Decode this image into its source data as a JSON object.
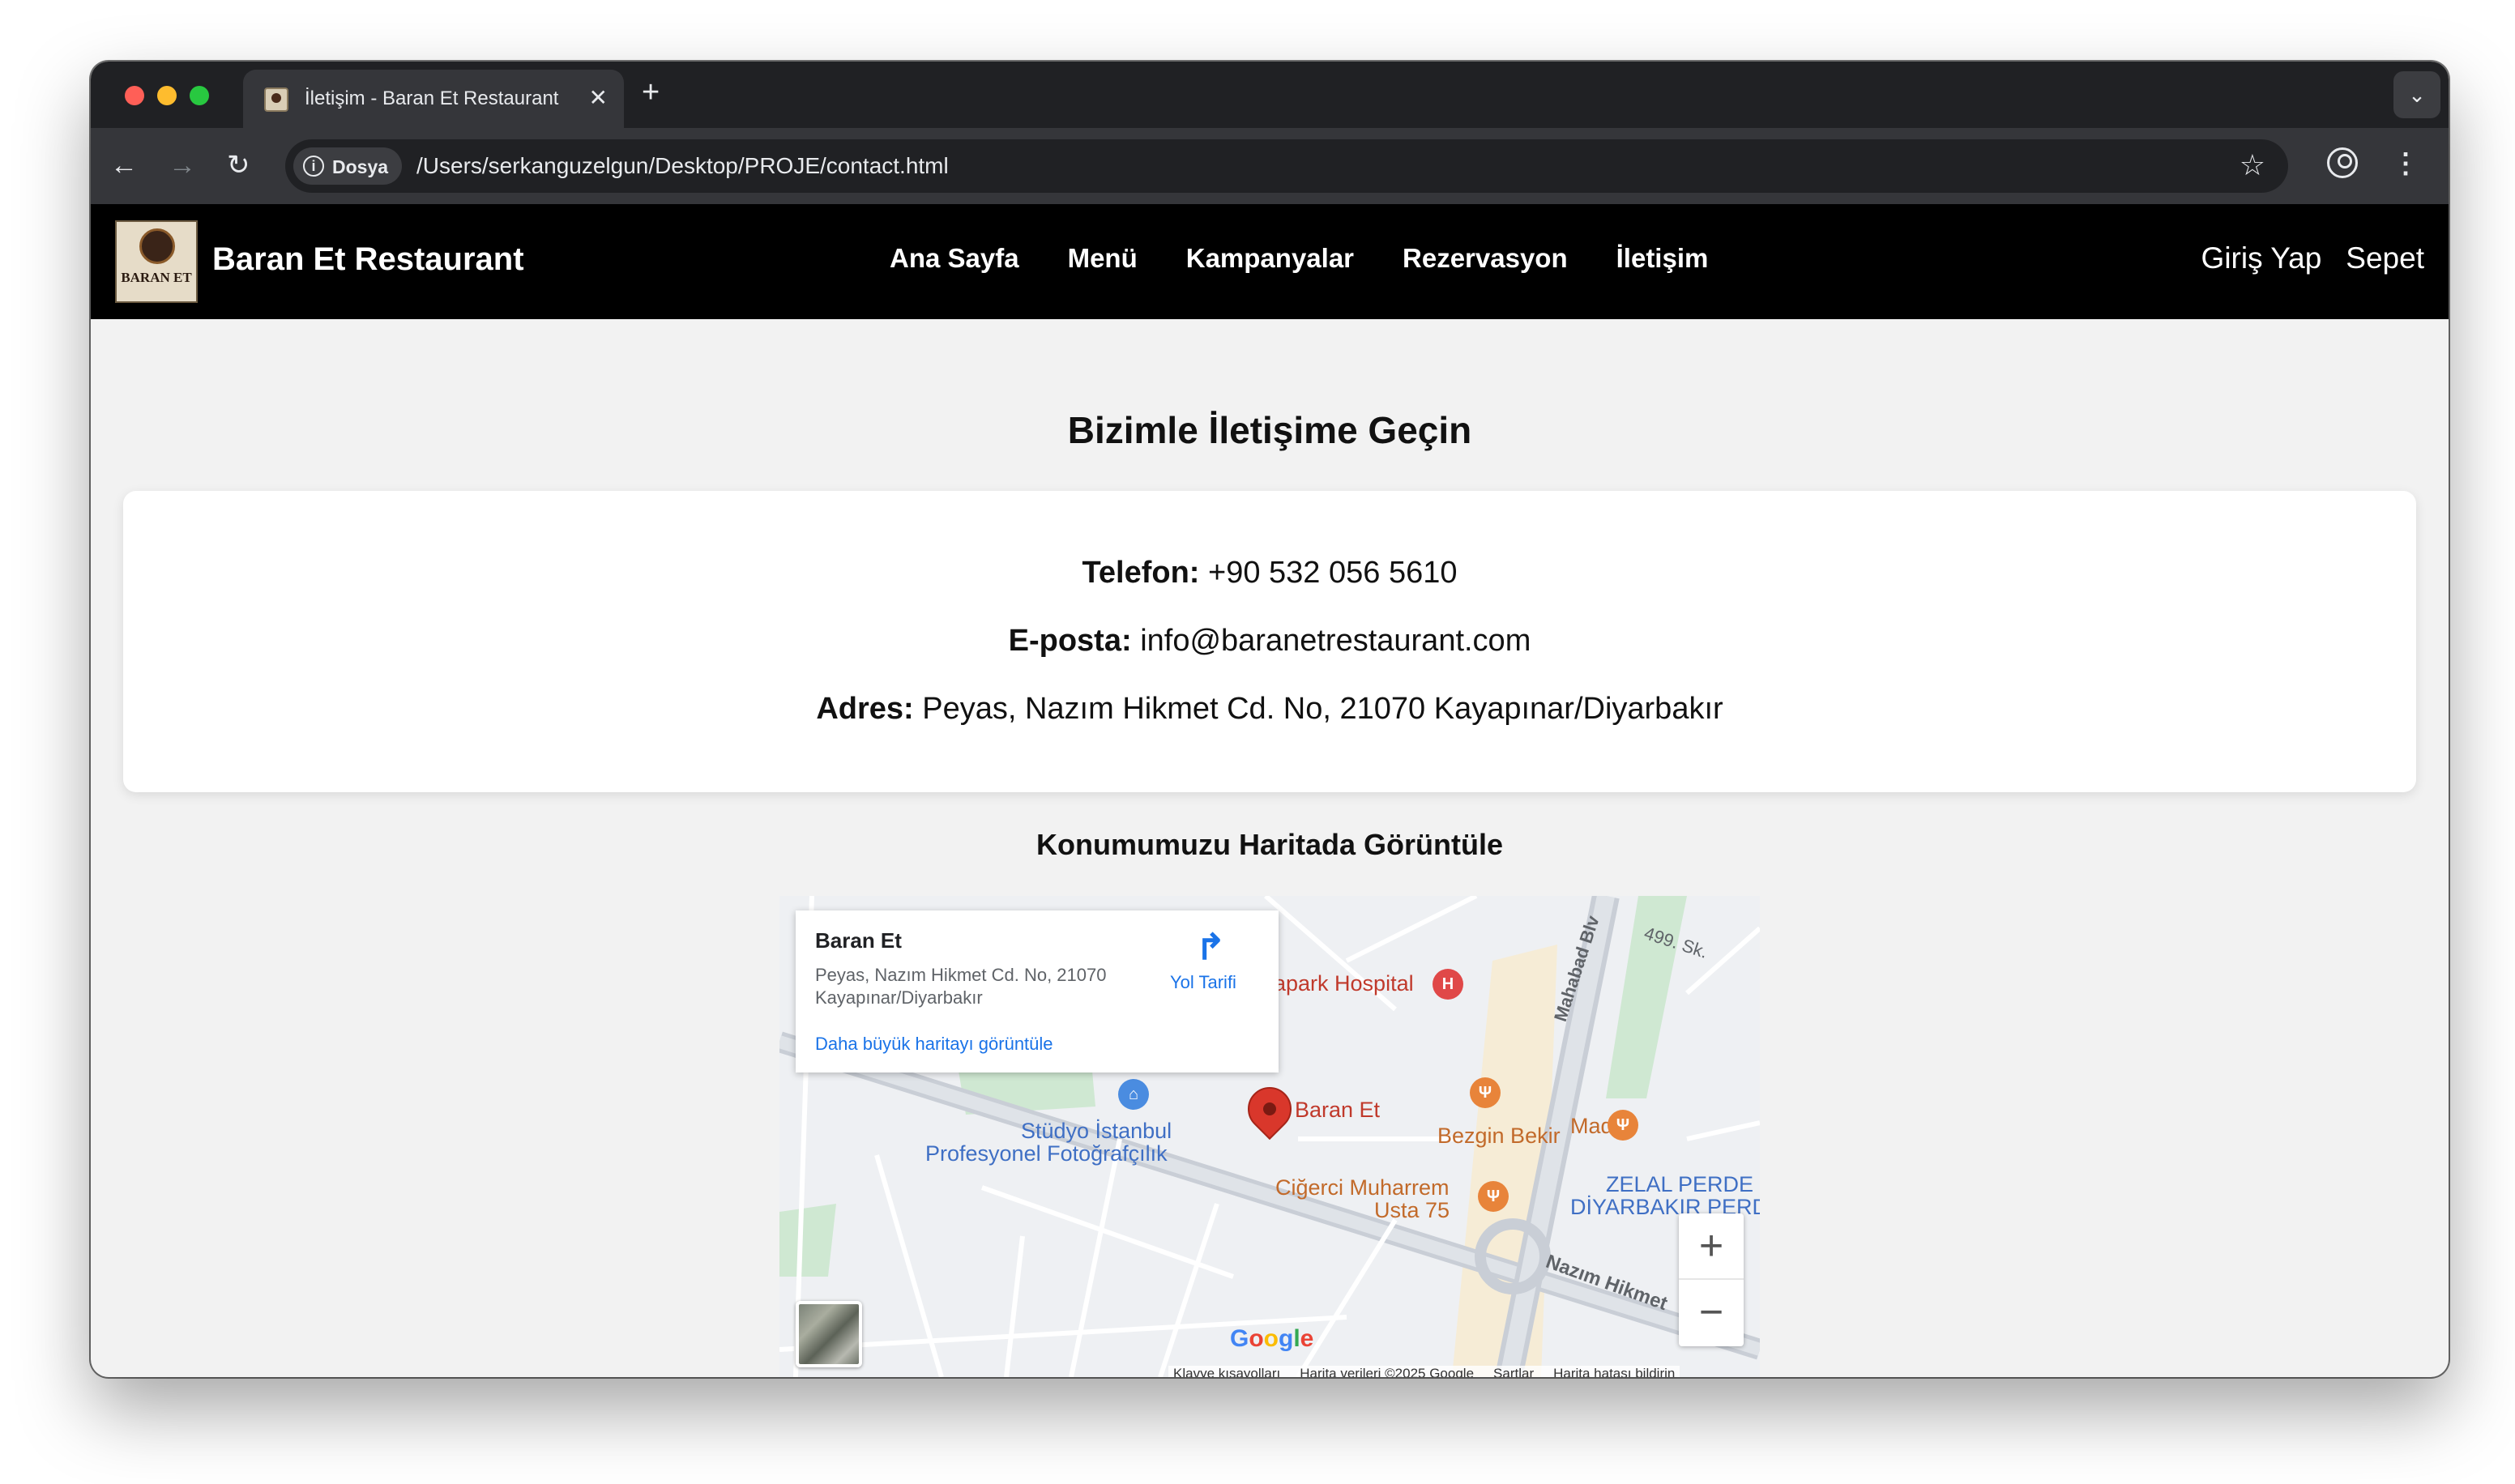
{
  "browser": {
    "tab_title": "İletişim - Baran Et Restaurant",
    "tab_close": "✕",
    "new_tab": "+",
    "tab_menu": "⌄",
    "site_chip_label": "Dosya",
    "url": "/Users/serkanguzelgun/Desktop/PROJE/contact.html",
    "icons": [
      "back-arrow-icon",
      "forward-arrow-icon",
      "reload-icon",
      "info-icon",
      "star-icon",
      "profile-icon",
      "kebab-menu-icon"
    ]
  },
  "site": {
    "logo_text": "BARAN ET",
    "brand": "Baran Et Restaurant",
    "nav": [
      "Ana Sayfa",
      "Menü",
      "Kampanyalar",
      "Rezervasyon",
      "İletişim"
    ],
    "auth": {
      "login": "Giriş Yap",
      "cart": "Sepet"
    }
  },
  "contact": {
    "heading": "Bizimle İletişime Geçin",
    "phone_label": "Telefon:",
    "phone": "+90 532 056 5610",
    "email_label": "E-posta:",
    "email": "info@baranetrestaurant.com",
    "address_label": "Adres:",
    "address": "Peyas, Nazım Hikmet Cd. No, 21070 Kayapınar/Diyarbakır"
  },
  "map": {
    "heading": "Konumumuzu Haritada Görüntüle",
    "info": {
      "title": "Baran Et",
      "address": "Peyas, Nazım Hikmet Cd. No, 21070 Kayapınar/Diyarbakır",
      "larger_map_link": "Daha büyük haritayı görüntüle",
      "directions_label": "Yol Tarifi"
    },
    "labels": {
      "pin": "Baran Et",
      "hospital": "apark Hospital",
      "studio_line1": "Stüdyo İstanbul",
      "studio_line2": "Profesyonel Fotoğrafçılık",
      "bezgin": "Bezgin Bekir",
      "mado": "Mado",
      "cigerci_line1": "Ciğerci Muharrem",
      "cigerci_line2": "Usta 75",
      "zelal_line1": "ZELAL PERDE",
      "zelal_line2": "DİYARBAKIR PERD",
      "mahabad": "Mahabad Blv",
      "street_499": "499. Sk.",
      "nazim": "Nazım Hikmet"
    },
    "zoom_in": "+",
    "zoom_out": "−",
    "google": "Google",
    "footer": [
      "Klavye kısayolları",
      "Harita verileri ©2025 Google",
      "Şartlar",
      "Harita hatası bildirin"
    ]
  },
  "colors": {
    "header_bg": "#000000",
    "page_bg": "#f2f2f2",
    "link_blue": "#1a73e8",
    "pin_red": "#d9372b"
  }
}
